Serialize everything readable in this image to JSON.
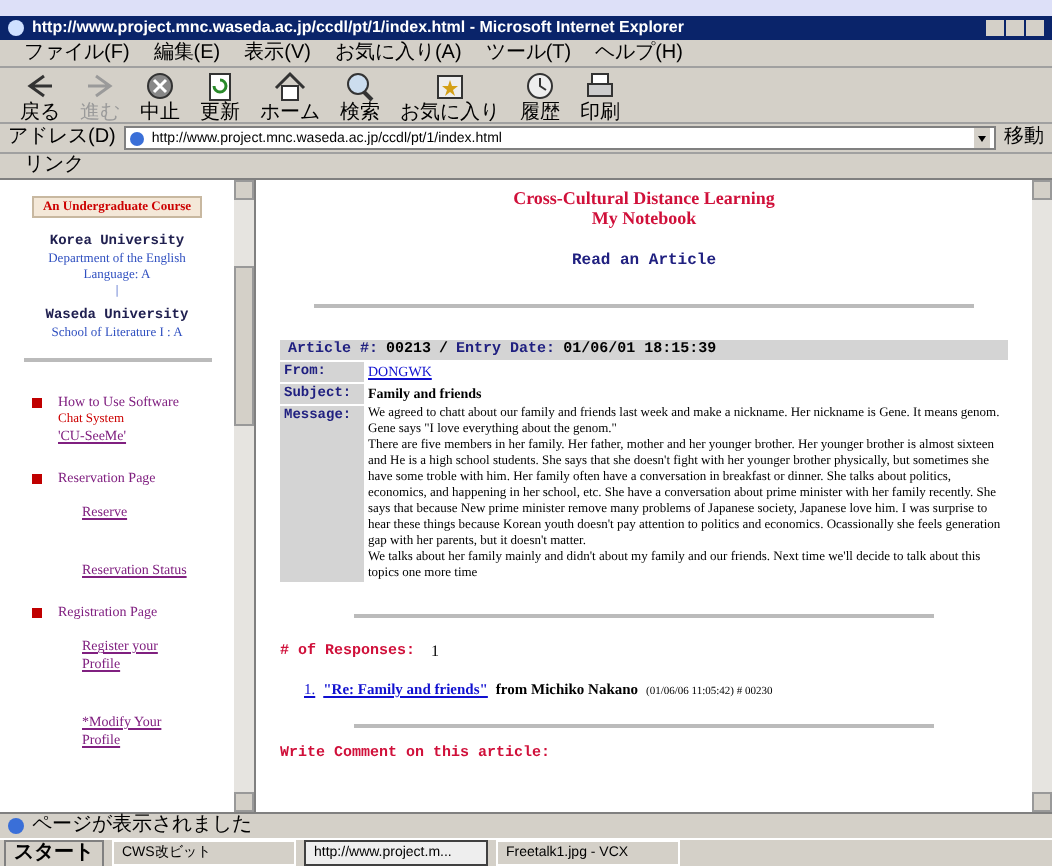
{
  "window": {
    "title": "http://www.project.mnc.waseda.ac.jp/ccdl/pt/1/index.html - Microsoft Internet Explorer"
  },
  "menu": [
    "ファイル(F)",
    "編集(E)",
    "表示(V)",
    "お気に入り(A)",
    "ツール(T)",
    "ヘルプ(H)"
  ],
  "toolbar": [
    {
      "kind": "back",
      "label": "戻る",
      "disabled": false
    },
    {
      "kind": "forward",
      "label": "進む",
      "disabled": true
    },
    {
      "kind": "stop",
      "label": "中止",
      "disabled": false
    },
    {
      "kind": "refresh",
      "label": "更新",
      "disabled": false
    },
    {
      "kind": "home",
      "label": "ホーム",
      "disabled": false
    },
    {
      "kind": "search",
      "label": "検索",
      "disabled": false
    },
    {
      "kind": "favorites",
      "label": "お気に入り",
      "disabled": false
    },
    {
      "kind": "history",
      "label": "履歴",
      "disabled": false
    },
    {
      "kind": "print",
      "label": "印刷",
      "disabled": false
    }
  ],
  "address_bar": {
    "label": "アドレス(D)",
    "value": "http://www.project.mnc.waseda.ac.jp/ccdl/pt/1/index.html",
    "go": "移動"
  },
  "links_bar": {
    "label": "リンク"
  },
  "sidebar": {
    "course": "An Undergraduate Course",
    "universities": [
      {
        "name": "Korea University",
        "department": "Department of the English Language: A"
      },
      {
        "name": "Waseda University",
        "department": "School of Literature I : A"
      }
    ],
    "separator": "|",
    "sections": [
      {
        "title": "How to Use Software",
        "note": "Chat System",
        "links": [
          "'CU-SeeMe'"
        ]
      },
      {
        "title": "Reservation Page",
        "links": [
          "Reserve",
          "Reservation Status"
        ]
      },
      {
        "title": "Registration Page",
        "links": [
          "Register your Profile",
          "*Modify Your Profile"
        ]
      }
    ]
  },
  "main": {
    "title": "Cross-Cultural Distance Learning",
    "subtitle": "My Notebook",
    "heading": "Read an Article",
    "article": {
      "number_label": "Article #:",
      "number": "00213",
      "separator": "/",
      "date_label": "Entry Date:",
      "date": "01/06/01 18:15:39",
      "fields": [
        {
          "kind": "link",
          "label": "From:",
          "value": "DONGWK"
        },
        {
          "kind": "bold",
          "label": "Subject:",
          "value": "Family and friends"
        }
      ],
      "message_label": "Message:",
      "message": [
        "We agreed to chatt about our family and friends last week and make a nickname. Her nickname is Gene. It means genom. Gene says \"I love everything about the genom.\"",
        "There are five members in her family. Her father, mother and her younger brother. Her younger brother is almost sixteen and He is a high school students. She says that she doesn't fight with her younger brother physically, but sometimes she have some troble with him. Her family often have a conversation in breakfast or dinner. She talks about politics, economics, and happening in her school, etc. She have a conversation about prime minister with her family recently. She says that because New prime minister remove many problems of Japanese society, Japanese love him. I was surprise to hear these things because Korean youth doesn't pay attention to politics and economics. Ocassionally she feels generation gap with her parents, but it doesn't matter.",
        "We talks about her family mainly and didn't about my family and our friends. Next time we'll decide to talk about this topics one more time"
      ]
    },
    "responses_label": "# of Responses:",
    "responses_count": "1",
    "responses": [
      {
        "number": "1.",
        "title": "\"Re: Family and friends\"",
        "from": "from Michiko Nakano",
        "meta": "(01/06/06 11:05:42) # 00230"
      }
    ],
    "comment_heading": "Write Comment on this article:"
  },
  "status_bar": {
    "text": "ページが表示されました"
  },
  "taskbar": {
    "start": "スタート",
    "items": [
      {
        "label": "CWS改ビット",
        "selected": false
      },
      {
        "label": "http://www.project.m...",
        "selected": true
      },
      {
        "label": "Freetalk1.jpg - VCX",
        "selected": false
      }
    ]
  }
}
